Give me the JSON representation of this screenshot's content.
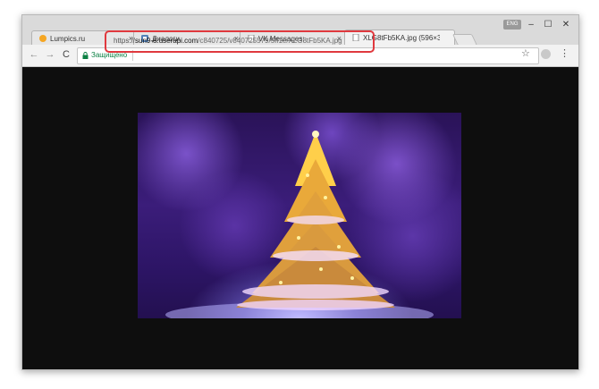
{
  "browser": {
    "tabs": [
      {
        "title": "Lumpics.ru",
        "favicon": "orange-circle-icon",
        "active": false
      },
      {
        "title": "Диалоги",
        "favicon": "vk-icon",
        "active": false
      },
      {
        "title": "VK Messages:",
        "favicon": "document-icon",
        "active": false
      },
      {
        "title": "XLG8tFb5KA.jpg (596×3",
        "favicon": "document-icon",
        "active": true
      }
    ],
    "lang_badge": "ENG",
    "window_controls": {
      "minimize": "–",
      "maximize": "☐",
      "close": "✕"
    }
  },
  "toolbar": {
    "back": "←",
    "forward": "→",
    "reload": "C",
    "security_label": "Защищено",
    "url": {
      "scheme": "https://",
      "host": "sun9-8.userapi.com",
      "path": "/c840725/v840725579/5ff1e/XLG8tFb5KA.jpg"
    },
    "star": "☆",
    "menu": "⋮"
  },
  "colors": {
    "highlight": "#e0393e",
    "secure_text": "#0b8043",
    "viewport_bg": "#0e0e0e"
  },
  "content": {
    "image_subject": "christmas-tree-photo"
  }
}
